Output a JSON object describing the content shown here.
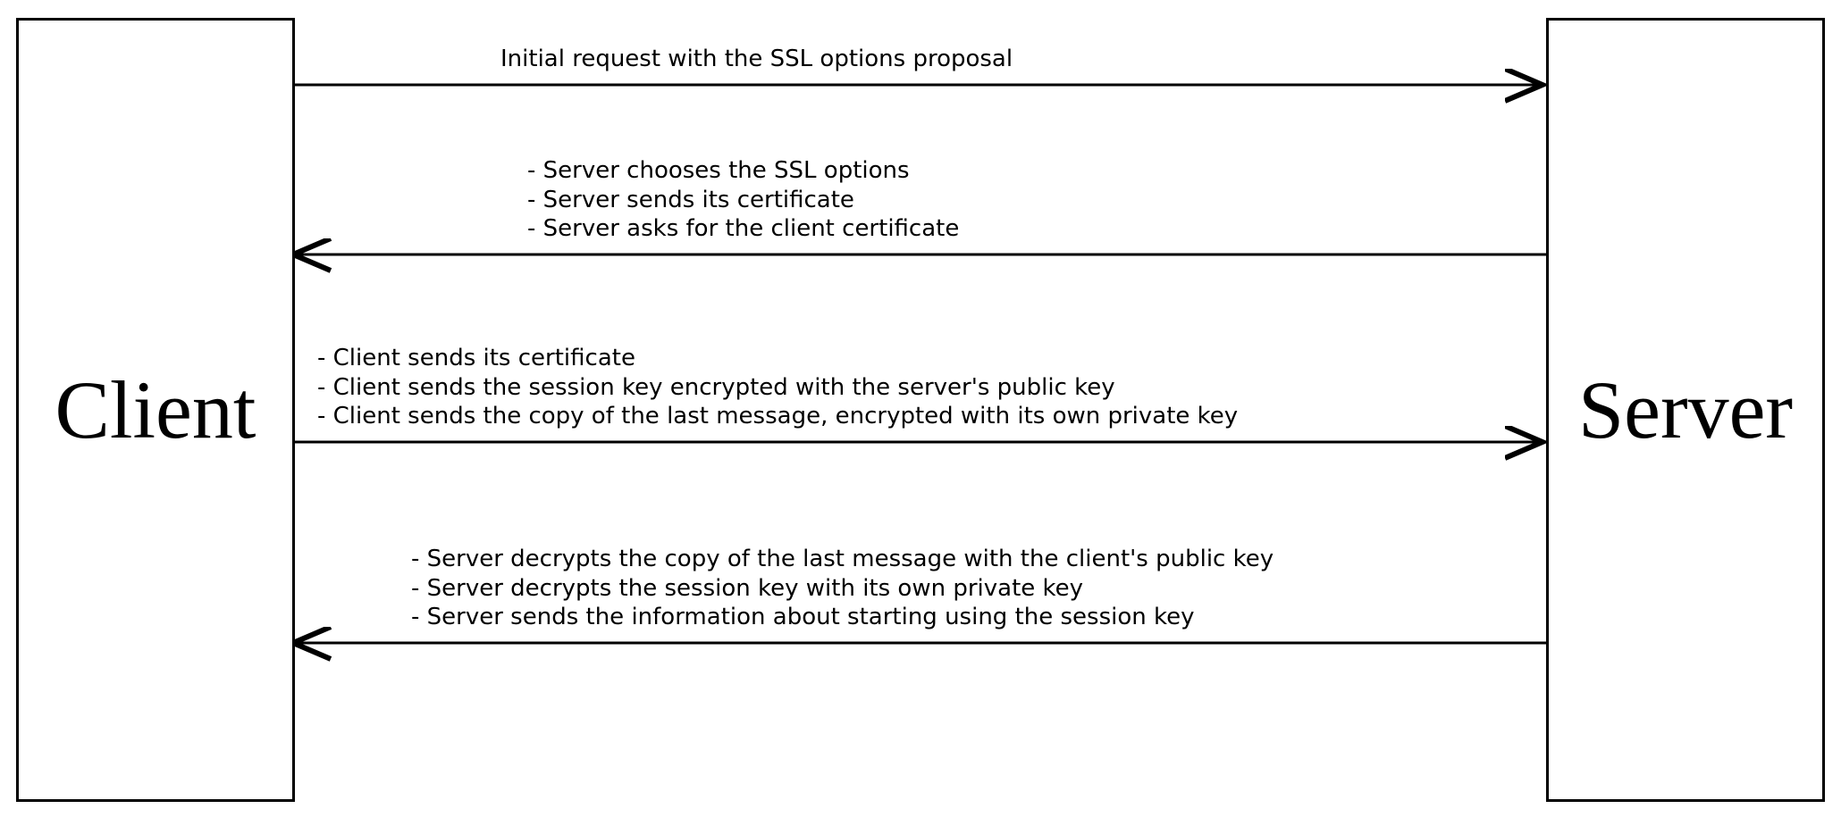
{
  "actors": {
    "client": "Client",
    "server": "Server"
  },
  "messages": {
    "m1": {
      "direction": "right",
      "lines": [
        "Initial request with the SSL options proposal"
      ]
    },
    "m2": {
      "direction": "left",
      "lines": [
        "- Server chooses the SSL options",
        "- Server sends its certificate",
        "- Server asks for the client certificate"
      ]
    },
    "m3": {
      "direction": "right",
      "lines": [
        "- Client sends its certificate",
        "- Client sends the session key encrypted with the server's public key",
        "- Client sends the copy of the last message, encrypted with its own private key"
      ]
    },
    "m4": {
      "direction": "left",
      "lines": [
        "- Server decrypts the copy of the last message with the client's public key",
        "- Server decrypts the session key with its own private key",
        "- Server sends the information about starting using the session key"
      ]
    }
  }
}
